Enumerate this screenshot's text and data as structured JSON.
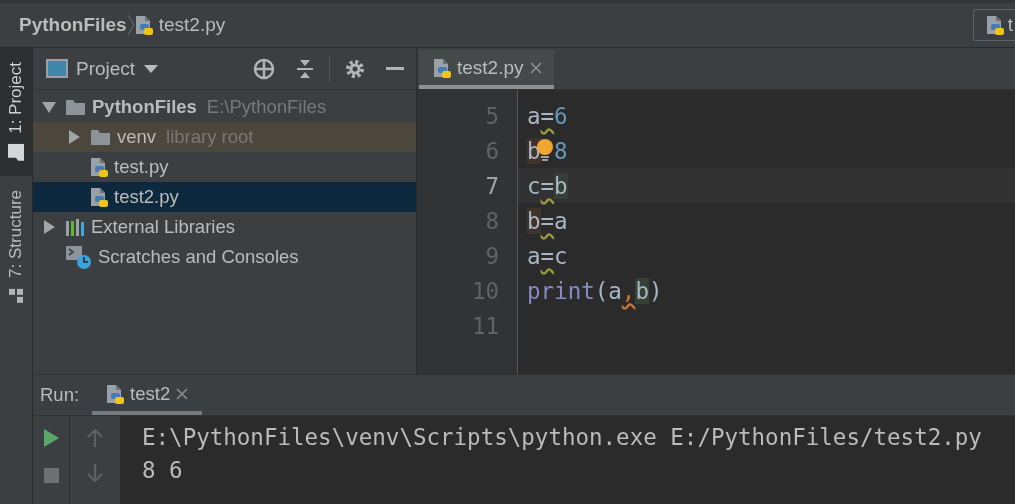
{
  "navbar": {
    "breadcrumbs": [
      {
        "label": "PythonFiles",
        "kind": "folder"
      },
      {
        "label": "test2.py",
        "kind": "python-file"
      }
    ],
    "run_config": {
      "label": "t"
    }
  },
  "tool_strip": [
    {
      "label": "1: Project",
      "kind": "project",
      "selected": true
    },
    {
      "label": "7: Structure",
      "kind": "structure",
      "selected": false
    }
  ],
  "project": {
    "title": "Project",
    "tree": [
      {
        "label": "PythonFiles",
        "hint": "E:\\PythonFiles",
        "kind": "project-root",
        "expanded": true,
        "selected": false,
        "children": [
          {
            "label": "venv",
            "hint": "library root",
            "kind": "library-root",
            "expanded": false,
            "selected": false
          },
          {
            "label": "test.py",
            "kind": "python-file",
            "selected": false
          },
          {
            "label": "test2.py",
            "kind": "python-file",
            "selected": true
          }
        ]
      },
      {
        "label": "External Libraries",
        "kind": "libraries",
        "expanded": false,
        "selected": false
      },
      {
        "label": "Scratches and Consoles",
        "kind": "scratches",
        "selected": false
      }
    ]
  },
  "editor": {
    "tabs": [
      {
        "label": "test2.py",
        "selected": true
      }
    ],
    "lines": [
      {
        "number": "5",
        "current": false,
        "intention": false,
        "tokens": [
          {
            "text": "a",
            "kind": "name",
            "written": false,
            "read": false,
            "warning": false
          },
          {
            "text": "=",
            "kind": "op",
            "written": false,
            "read": false,
            "warning": true
          },
          {
            "text": "6",
            "kind": "number",
            "written": false,
            "read": false,
            "warning": false
          }
        ]
      },
      {
        "number": "6",
        "current": false,
        "intention": true,
        "tokens": [
          {
            "text": "b",
            "kind": "name",
            "written": true,
            "read": false,
            "warning": false
          },
          {
            "text": "8",
            "kind": "number",
            "written": false,
            "read": false,
            "warning": false
          }
        ]
      },
      {
        "number": "7",
        "current": true,
        "intention": false,
        "tokens": [
          {
            "text": "c",
            "kind": "name",
            "written": false,
            "read": false,
            "warning": false
          },
          {
            "text": "=",
            "kind": "op",
            "written": false,
            "read": false,
            "warning": true
          },
          {
            "text": "b",
            "kind": "name",
            "written": false,
            "read": true,
            "warning": false
          }
        ]
      },
      {
        "number": "8",
        "current": false,
        "intention": false,
        "tokens": [
          {
            "text": "b",
            "kind": "name",
            "written": true,
            "read": false,
            "warning": false
          },
          {
            "text": "=",
            "kind": "op",
            "written": false,
            "read": false,
            "warning": true
          },
          {
            "text": "a",
            "kind": "name",
            "written": false,
            "read": false,
            "warning": false
          }
        ]
      },
      {
        "number": "9",
        "current": false,
        "intention": false,
        "tokens": [
          {
            "text": "a",
            "kind": "name",
            "written": false,
            "read": false,
            "warning": false
          },
          {
            "text": "=",
            "kind": "op",
            "written": false,
            "read": false,
            "warning": true
          },
          {
            "text": "c",
            "kind": "name",
            "written": false,
            "read": false,
            "warning": false
          }
        ]
      },
      {
        "number": "10",
        "current": false,
        "intention": false,
        "tokens": [
          {
            "text": "print",
            "kind": "builtin",
            "written": false,
            "read": false,
            "warning": false
          },
          {
            "text": "(",
            "kind": "op",
            "written": false,
            "read": false,
            "warning": false
          },
          {
            "text": "a",
            "kind": "name",
            "written": false,
            "read": false,
            "warning": false
          },
          {
            "text": ",",
            "kind": "error",
            "written": false,
            "read": false,
            "warning": true
          },
          {
            "text": "b",
            "kind": "name",
            "written": false,
            "read": true,
            "warning": false
          },
          {
            "text": ")",
            "kind": "op",
            "written": false,
            "read": false,
            "warning": false
          }
        ]
      },
      {
        "number": "11",
        "current": false,
        "intention": false
      }
    ]
  },
  "run": {
    "title": "Run:",
    "tabs": [
      {
        "label": "test2",
        "selected": true
      }
    ],
    "output": [
      "E:\\PythonFiles\\venv\\Scripts\\python.exe E:/PythonFiles/test2.py",
      "8 6"
    ]
  }
}
